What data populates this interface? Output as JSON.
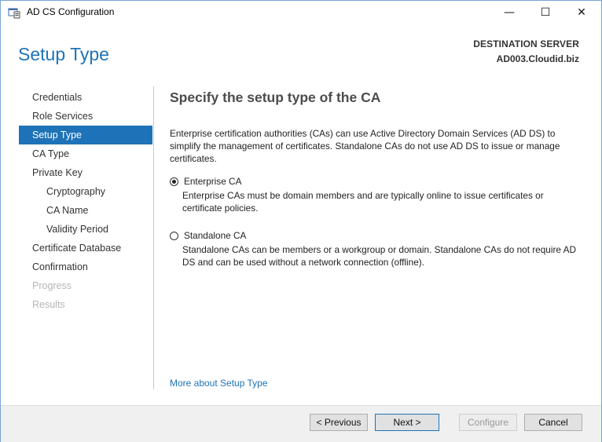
{
  "window": {
    "title": "AD CS Configuration",
    "controls": {
      "minimize": "—",
      "maximize": "☐",
      "close": "✕"
    }
  },
  "header": {
    "page_title": "Setup Type",
    "destination_label": "DESTINATION SERVER",
    "destination_server": "AD003.Cloudid.biz"
  },
  "nav": {
    "items": [
      {
        "label": "Credentials"
      },
      {
        "label": "Role Services"
      },
      {
        "label": "Setup Type"
      },
      {
        "label": "CA Type"
      },
      {
        "label": "Private Key"
      },
      {
        "label": "Cryptography"
      },
      {
        "label": "CA Name"
      },
      {
        "label": "Validity Period"
      },
      {
        "label": "Certificate Database"
      },
      {
        "label": "Confirmation"
      },
      {
        "label": "Progress"
      },
      {
        "label": "Results"
      }
    ],
    "active": "Setup Type"
  },
  "main": {
    "heading": "Specify the setup type of the CA",
    "description": "Enterprise certification authorities (CAs) can use Active Directory Domain Services (AD DS) to simplify the management of certificates. Standalone CAs do not use AD DS to issue or manage certificates.",
    "options": [
      {
        "label": "Enterprise CA",
        "description": "Enterprise CAs must be domain members and are typically online to issue certificates or certificate policies.",
        "selected": true
      },
      {
        "label": "Standalone CA",
        "description": "Standalone CAs can be members or a workgroup or domain. Standalone CAs do not require AD DS and can be used without a network connection (offline).",
        "selected": false
      }
    ],
    "more_link": "More about Setup Type"
  },
  "footer": {
    "previous": "< Previous",
    "next": "Next >",
    "configure": "Configure",
    "cancel": "Cancel"
  },
  "colors": {
    "accent": "#1e73b8",
    "disabled_text": "#b5b5b5",
    "footer_bg": "#f0f0f0"
  }
}
